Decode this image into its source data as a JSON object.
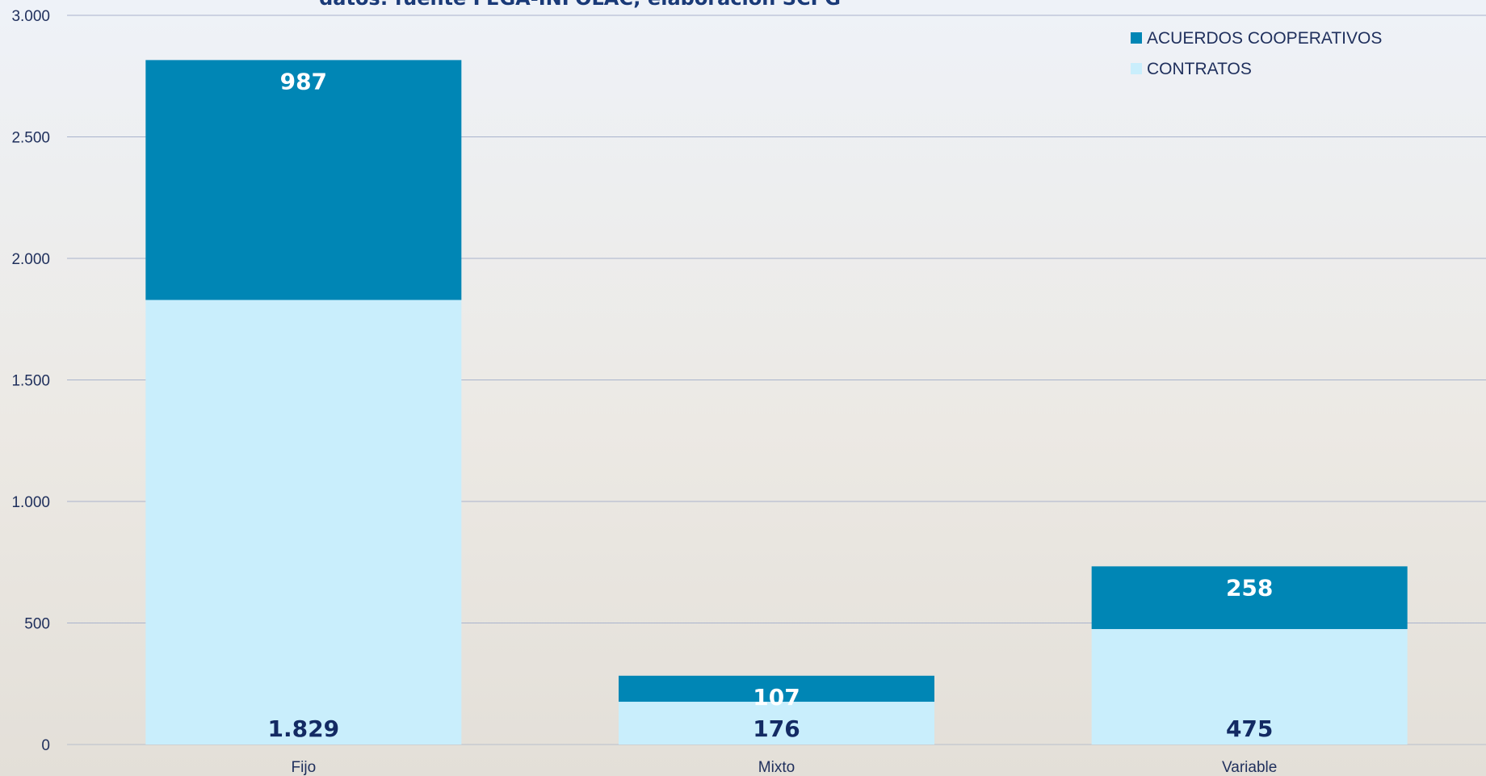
{
  "header": {
    "subtitle": "datos: fuente FEGA-INFOLAC; elaboración SCPG"
  },
  "chart_data": {
    "type": "bar",
    "stacked": true,
    "categories": [
      "Fijo",
      "Mixto",
      "Variable"
    ],
    "series": [
      {
        "name": "CONTRATOS",
        "values": [
          1829,
          176,
          475
        ],
        "labels": [
          "1.829",
          "176",
          "475"
        ],
        "color": "#c9eefc"
      },
      {
        "name": "ACUERDOS COOPERATIVOS",
        "values": [
          987,
          107,
          258
        ],
        "labels": [
          "987",
          "107",
          "258"
        ],
        "color": "#0086b5"
      }
    ],
    "ylim": [
      0,
      3000
    ],
    "yticks": [
      0,
      500,
      1000,
      1500,
      2000,
      2500,
      3000
    ],
    "ytick_labels": [
      "0",
      "500",
      "1.000",
      "1.500",
      "2.000",
      "2.500",
      "3.000"
    ],
    "grid": true,
    "legend_position": "top-right",
    "legend_order": [
      "ACUERDOS COOPERATIVOS",
      "CONTRATOS"
    ],
    "xlabel": "",
    "ylabel": ""
  }
}
